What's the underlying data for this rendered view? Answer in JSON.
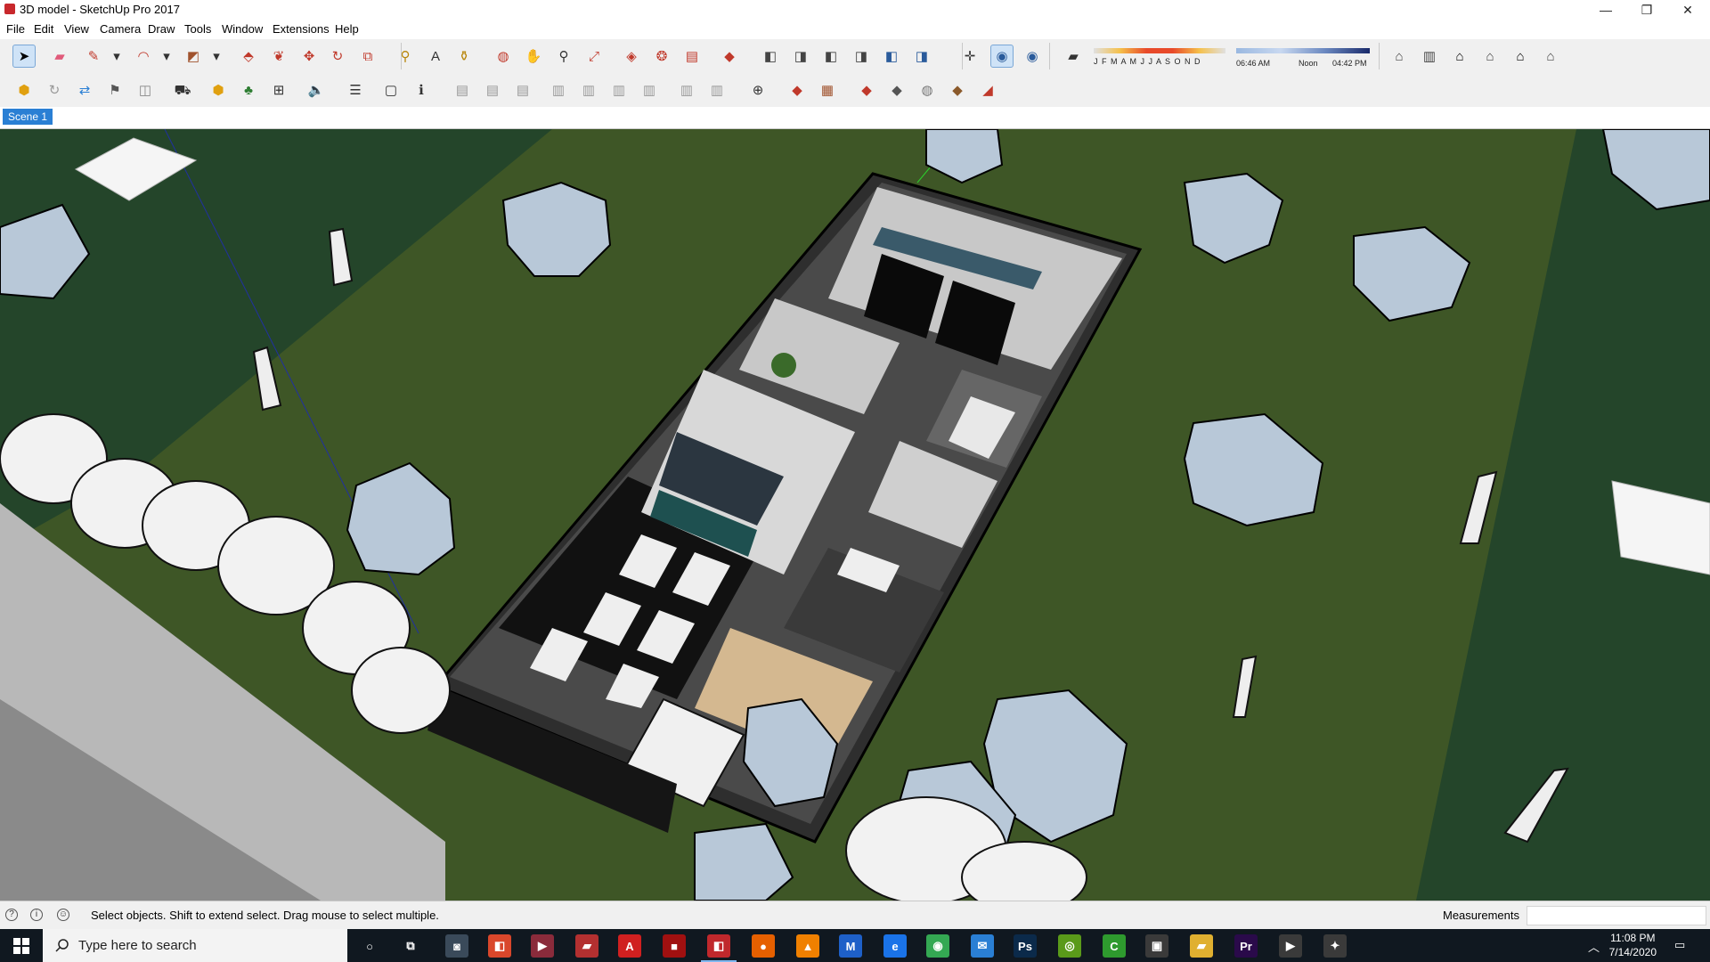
{
  "window": {
    "title": "3D model - SketchUp Pro 2017",
    "minimize": "—",
    "maximize": "❐",
    "close": "✕"
  },
  "menu": [
    "File",
    "Edit",
    "View",
    "Camera",
    "Draw",
    "Tools",
    "Window",
    "Extensions",
    "Help"
  ],
  "toolbar1": [
    {
      "name": "select-icon",
      "glyph": "➤",
      "color": "#000",
      "active": true
    },
    {
      "name": "eraser-icon",
      "glyph": "▰",
      "color": "#e05a7a"
    },
    {
      "name": "pencil-line-icon",
      "glyph": "✎",
      "color": "#c0392b"
    },
    {
      "name": "dropdown-icon",
      "glyph": "▾",
      "color": "#333"
    },
    {
      "name": "arc-icon",
      "glyph": "◠",
      "color": "#c0392b"
    },
    {
      "name": "dropdown-icon",
      "glyph": "▾",
      "color": "#333"
    },
    {
      "name": "rectangle-icon",
      "glyph": "◩",
      "color": "#a0522d"
    },
    {
      "name": "dropdown-icon",
      "glyph": "▾",
      "color": "#333"
    },
    {
      "name": "push-pull-icon",
      "glyph": "⬘",
      "color": "#c0392b"
    },
    {
      "name": "follow-me-icon",
      "glyph": "❦",
      "color": "#c0392b"
    },
    {
      "name": "move-icon",
      "glyph": "✥",
      "color": "#c0392b"
    },
    {
      "name": "rotate-icon",
      "glyph": "↻",
      "color": "#c0392b"
    },
    {
      "name": "scale-icon",
      "glyph": "⧉",
      "color": "#c0392b"
    },
    {
      "name": "tape-measure-icon",
      "glyph": "⚲",
      "color": "#b8860b"
    },
    {
      "name": "text-icon",
      "glyph": "A",
      "color": "#333"
    },
    {
      "name": "paint-bucket-icon",
      "glyph": "⚱",
      "color": "#b8860b"
    },
    {
      "name": "orbit-icon",
      "glyph": "◍",
      "color": "#c0392b"
    },
    {
      "name": "pan-icon",
      "glyph": "✋",
      "color": "#d4a017"
    },
    {
      "name": "zoom-icon",
      "glyph": "⚲",
      "color": "#333"
    },
    {
      "name": "zoom-extents-icon",
      "glyph": "⤢",
      "color": "#c0392b"
    },
    {
      "name": "component-icon",
      "glyph": "◈",
      "color": "#c0392b"
    },
    {
      "name": "warehouse-icon",
      "glyph": "❂",
      "color": "#c0392b"
    },
    {
      "name": "share-model-icon",
      "glyph": "▤",
      "color": "#c0392b"
    },
    {
      "name": "ruby-icon",
      "glyph": "◆",
      "color": "#c0392b"
    },
    {
      "name": "view-iso-icon",
      "glyph": "◧",
      "color": "#444"
    },
    {
      "name": "view-top-icon",
      "glyph": "◨",
      "color": "#444"
    },
    {
      "name": "view-front-icon",
      "glyph": "◧",
      "color": "#444"
    },
    {
      "name": "view-right-icon",
      "glyph": "◨",
      "color": "#444"
    },
    {
      "name": "view-back-icon",
      "glyph": "◧",
      "color": "#2a5b9b"
    },
    {
      "name": "view-left-icon",
      "glyph": "◨",
      "color": "#2a5b9b"
    },
    {
      "name": "axes-icon",
      "glyph": "✛",
      "color": "#333"
    },
    {
      "name": "shadows-toggle-icon",
      "glyph": "◉",
      "color": "#2a5b9b",
      "active": true
    },
    {
      "name": "fog-toggle-icon",
      "glyph": "◉",
      "color": "#2a5b9b"
    },
    {
      "name": "shadow-settings-icon",
      "glyph": "▰",
      "color": "#333"
    }
  ],
  "shadow": {
    "months": "J F M A M J J A S O N D",
    "time_start": "06:46 AM",
    "time_mid": "Noon",
    "time_end": "04:42 PM"
  },
  "toolbar1_right": [
    {
      "name": "camera-views-icon",
      "glyph": "⌂",
      "color": "#444"
    },
    {
      "name": "section-icon",
      "glyph": "▥",
      "color": "#444"
    },
    {
      "name": "home-icon",
      "glyph": "⌂",
      "color": "#000"
    },
    {
      "name": "house-front-icon",
      "glyph": "⌂",
      "color": "#444"
    },
    {
      "name": "house-outline-icon",
      "glyph": "⌂",
      "color": "#000"
    },
    {
      "name": "house-side-icon",
      "glyph": "⌂",
      "color": "#444"
    }
  ],
  "toolbar2": [
    {
      "name": "extension-warehouse-icon",
      "glyph": "⬢",
      "color": "#e0a010"
    },
    {
      "name": "refresh-icon",
      "glyph": "↻",
      "color": "#999"
    },
    {
      "name": "import-icon",
      "glyph": "⇄",
      "color": "#2a7fd4"
    },
    {
      "name": "camera-position-icon",
      "glyph": "⚑",
      "color": "#555"
    },
    {
      "name": "photo-icon",
      "glyph": "◫",
      "color": "#888"
    },
    {
      "name": "sandbox-icon",
      "glyph": "⛟",
      "color": "#333"
    },
    {
      "name": "add-location-icon",
      "glyph": "⬢",
      "color": "#e0a010"
    },
    {
      "name": "tree-icon",
      "glyph": "♣",
      "color": "#2e7d32"
    },
    {
      "name": "geo-icon",
      "glyph": "⊞",
      "color": "#333"
    },
    {
      "name": "sound-icon",
      "glyph": "🔈",
      "color": "#333"
    },
    {
      "name": "settings-sliders-icon",
      "glyph": "☰",
      "color": "#333"
    },
    {
      "name": "dialog-icon",
      "glyph": "▢",
      "color": "#333"
    },
    {
      "name": "info-icon",
      "glyph": "ℹ",
      "color": "#333"
    },
    {
      "name": "doc-text-icon",
      "glyph": "▤",
      "color": "#999"
    },
    {
      "name": "doc-exe-icon",
      "glyph": "▤",
      "color": "#999"
    },
    {
      "name": "doc-web-icon",
      "glyph": "▤",
      "color": "#999"
    },
    {
      "name": "layout-1-icon",
      "glyph": "▥",
      "color": "#999"
    },
    {
      "name": "layout-2-icon",
      "glyph": "▥",
      "color": "#999"
    },
    {
      "name": "layout-3-icon",
      "glyph": "▥",
      "color": "#999"
    },
    {
      "name": "layout-4-icon",
      "glyph": "▥",
      "color": "#999"
    },
    {
      "name": "layout-5-icon",
      "glyph": "▥",
      "color": "#999"
    },
    {
      "name": "layout-6-icon",
      "glyph": "▥",
      "color": "#999"
    },
    {
      "name": "globe-icon",
      "glyph": "⊕",
      "color": "#333"
    },
    {
      "name": "paint-red-icon",
      "glyph": "◆",
      "color": "#c0392b"
    },
    {
      "name": "texture-icon",
      "glyph": "▦",
      "color": "#a0522d"
    },
    {
      "name": "object-1-icon",
      "glyph": "◆",
      "color": "#c0392b"
    },
    {
      "name": "object-2-icon",
      "glyph": "◆",
      "color": "#555"
    },
    {
      "name": "object-3-icon",
      "glyph": "◍",
      "color": "#777"
    },
    {
      "name": "object-4-icon",
      "glyph": "◆",
      "color": "#8b5a2b"
    },
    {
      "name": "object-5-icon",
      "glyph": "◢",
      "color": "#c0392b"
    }
  ],
  "scene_tab": "Scene 1",
  "status": {
    "text": "Select objects. Shift to extend select. Drag mouse to select multiple.",
    "measurements_label": "Measurements",
    "measurements_value": "",
    "icon_1": "?",
    "icon_2": "i",
    "icon_3": "☺"
  },
  "taskbar": {
    "search_placeholder": "Type here to search",
    "time": "11:08 PM",
    "date": "7/14/2020",
    "apps": [
      {
        "name": "cortana-icon",
        "glyph": "○",
        "bg": "transparent"
      },
      {
        "name": "task-view-icon",
        "glyph": "⧉",
        "bg": "transparent"
      },
      {
        "name": "camera-app-icon",
        "glyph": "◙",
        "bg": "#3a4a5a"
      },
      {
        "name": "app-red-1-icon",
        "glyph": "◧",
        "bg": "#d9472b"
      },
      {
        "name": "media-player-icon",
        "glyph": "▶",
        "bg": "#8a2b3b"
      },
      {
        "name": "folder-red-icon",
        "glyph": "▰",
        "bg": "#b33030"
      },
      {
        "name": "acrobat-icon",
        "glyph": "A",
        "bg": "#d02020"
      },
      {
        "name": "app-red-2-icon",
        "glyph": "■",
        "bg": "#a01010"
      },
      {
        "name": "sketchup-icon",
        "glyph": "◧",
        "bg": "#c0282c",
        "running": true
      },
      {
        "name": "firefox-icon",
        "glyph": "●",
        "bg": "#e66000"
      },
      {
        "name": "vlc-icon",
        "glyph": "▲",
        "bg": "#f08000"
      },
      {
        "name": "app-m-icon",
        "glyph": "M",
        "bg": "#1e60c8"
      },
      {
        "name": "edge-icon",
        "glyph": "e",
        "bg": "#1a73e8"
      },
      {
        "name": "chrome-icon",
        "glyph": "◉",
        "bg": "#34a853"
      },
      {
        "name": "mail-icon",
        "glyph": "✉",
        "bg": "#2a7fd4"
      },
      {
        "name": "photoshop-icon",
        "glyph": "Ps",
        "bg": "#0b2a4a"
      },
      {
        "name": "nvidia-icon",
        "glyph": "◎",
        "bg": "#5a9a1a"
      },
      {
        "name": "camtasia-icon",
        "glyph": "C",
        "bg": "#2e9a2e"
      },
      {
        "name": "store-icon",
        "glyph": "▣",
        "bg": "#3a3a3a"
      },
      {
        "name": "file-explorer-icon",
        "glyph": "▰",
        "bg": "#e0b030"
      },
      {
        "name": "premiere-icon",
        "glyph": "Pr",
        "bg": "#2a0a4a"
      },
      {
        "name": "video-app-icon",
        "glyph": "▶",
        "bg": "#3a3a3a"
      },
      {
        "name": "app-bird-icon",
        "glyph": "✦",
        "bg": "#3a3a3a"
      }
    ]
  }
}
